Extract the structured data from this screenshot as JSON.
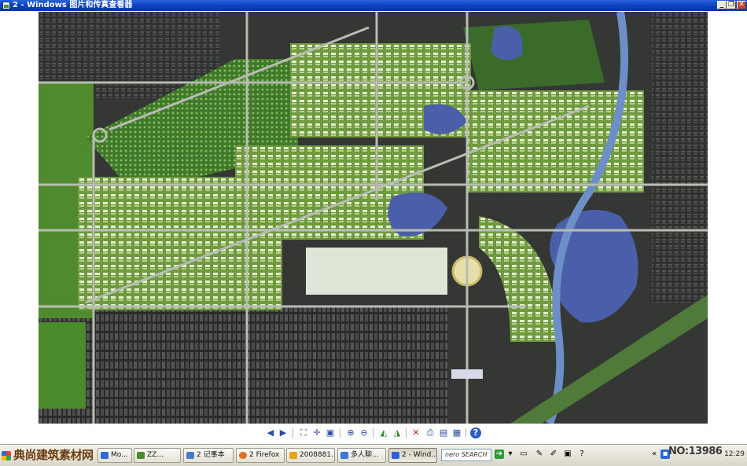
{
  "window": {
    "title": "2 - Windows 图片和传真查看器",
    "minimize_glyph": "_",
    "restore_glyph": "❐",
    "close_glyph": "✕"
  },
  "viewer": {
    "image": "urban master plan site map (aerial)",
    "colors": {
      "map_background": "#3a3c3a",
      "greenery": "#5f8e35",
      "water": "#4a5fa8",
      "road": "#b8bcb5"
    }
  },
  "toolbar": {
    "buttons": [
      {
        "name": "previous-image-button",
        "icon": "prev-icon",
        "glyph": "◀"
      },
      {
        "name": "next-image-button",
        "icon": "next-icon",
        "glyph": "▶"
      },
      {
        "name": "best-fit-button",
        "icon": "best-fit-icon",
        "glyph": "⛶"
      },
      {
        "name": "actual-size-button",
        "icon": "actual-size-icon",
        "glyph": "✛"
      },
      {
        "name": "slideshow-button",
        "icon": "slideshow-icon",
        "glyph": "▣"
      },
      {
        "name": "zoom-in-button",
        "icon": "zoom-in-icon",
        "glyph": "⊕"
      },
      {
        "name": "zoom-out-button",
        "icon": "zoom-out-icon",
        "glyph": "⊖"
      },
      {
        "name": "rotate-clockwise-button",
        "icon": "rotate-cw-icon",
        "glyph": "◭"
      },
      {
        "name": "rotate-counterclockwise-button",
        "icon": "rotate-ccw-icon",
        "glyph": "◮"
      },
      {
        "name": "delete-button",
        "icon": "delete-icon",
        "glyph": "✕"
      },
      {
        "name": "print-button",
        "icon": "print-icon",
        "glyph": "⎙"
      },
      {
        "name": "save-button",
        "icon": "save-icon",
        "glyph": "▤"
      },
      {
        "name": "edit-button",
        "icon": "edit-icon",
        "glyph": "▦"
      },
      {
        "name": "help-button",
        "icon": "help-icon",
        "glyph": "?"
      }
    ]
  },
  "taskbar": {
    "start_label": "典尚建筑素材网",
    "tasks": [
      {
        "label": "Mo...",
        "color": "#2d6bd1"
      },
      {
        "label": "ZZ...",
        "color": "#4a8a2a"
      },
      {
        "label": "2 记事本",
        "color": "#4a7ad0"
      },
      {
        "label": "2 Firefox",
        "color": "#e07020"
      },
      {
        "label": "2008881...",
        "color": "#e3a51a"
      },
      {
        "label": "多人聊...",
        "color": "#3a7ad0"
      },
      {
        "label": "2 - Wind...",
        "color": "#2a62d8",
        "active": true
      }
    ],
    "search_placeholder": "nero SEARCH",
    "watermark": "NO:13986",
    "clock": "12:29",
    "tray_chevron": "«"
  }
}
